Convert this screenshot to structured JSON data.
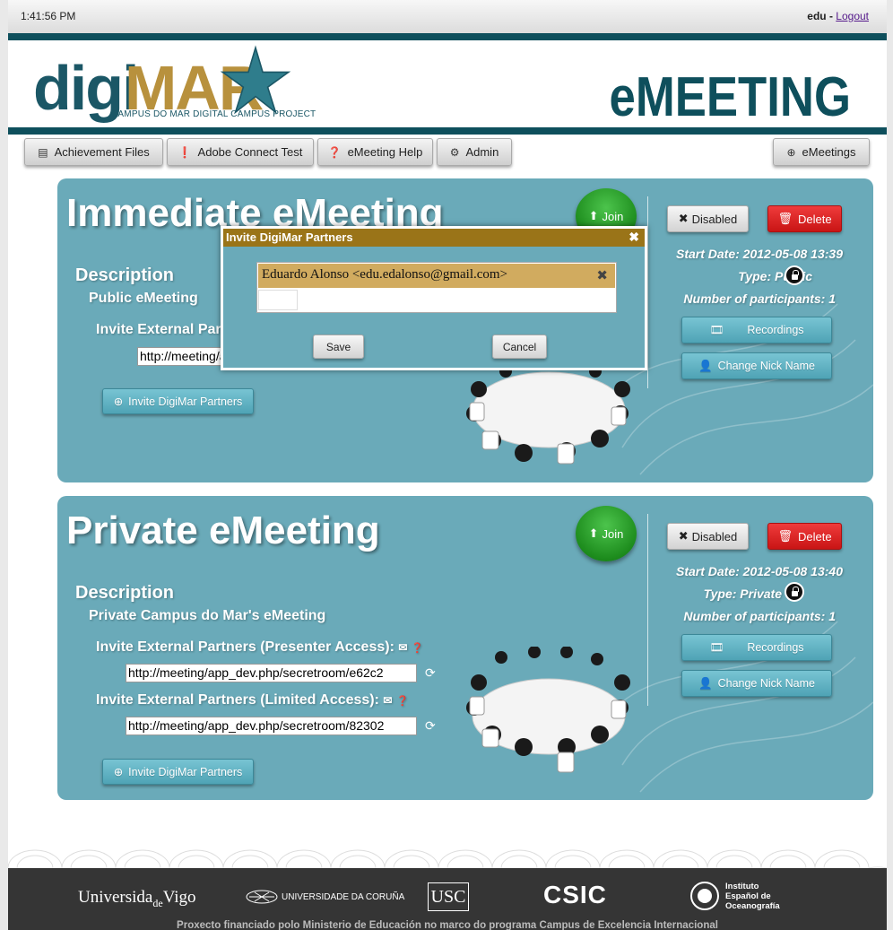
{
  "topbar": {
    "time": "1:41:56 PM",
    "username": "edu",
    "separator": " - ",
    "logout": "Logout"
  },
  "header": {
    "logo_digi": "digi",
    "logo_mar": "MAR",
    "logo_sub": "CAMPUS DO MAR DIGITAL CAMPUS PROJECT",
    "title": "eMEETING"
  },
  "nav": {
    "achievement": "Achievement Files",
    "adobe": "Adobe Connect Test",
    "help": "eMeeting Help",
    "admin": "Admin",
    "emeetings": "eMeetings"
  },
  "meetings": [
    {
      "title": "Immediate eMeeting",
      "join": "Join",
      "description_label": "Description",
      "description": "Public eMeeting",
      "invite_presenter_label": "Invite External Partners (Presenter Access):",
      "presenter_url": "http://meeting/app_dev.php/secretroom/e62c2",
      "invite_digimar": "Invite DigiMar Partners",
      "disabled": "Disabled",
      "delete": "Delete",
      "start_date": "Start Date: 2012-05-08 13:39",
      "type": "Type: Public",
      "participants": "Number of participants: 1",
      "recordings": "Recordings",
      "change_nick": "Change Nick Name"
    },
    {
      "title": "Private eMeeting",
      "join": "Join",
      "description_label": "Description",
      "description": "Private Campus do Mar's eMeeting",
      "invite_presenter_label": "Invite External Partners (Presenter Access):",
      "presenter_url": "http://meeting/app_dev.php/secretroom/e62c2",
      "invite_limited_label": "Invite External Partners (Limited Access):",
      "limited_url": "http://meeting/app_dev.php/secretroom/82302",
      "invite_digimar": "Invite DigiMar Partners",
      "disabled": "Disabled",
      "delete": "Delete",
      "start_date": "Start Date: 2012-05-08 13:40",
      "type": "Type: Private",
      "participants": "Number of participants: 1",
      "recordings": "Recordings",
      "change_nick": "Change Nick Name"
    }
  ],
  "dialog": {
    "title": "Invite DigiMar Partners",
    "selected": "Eduardo Alonso <edu.edalonso@gmail.com>",
    "save": "Save",
    "cancel": "Cancel"
  },
  "footer": {
    "vigo": "Universida de Vigo",
    "vigo_a": "Universida",
    "vigo_b": "de",
    "vigo_c": "Vigo",
    "coruna": "UNIVERSIDADE DA CORUÑA",
    "usc": "USC",
    "csic": "CSIC",
    "ieo": "Instituto Español de Oceanografía",
    "ieo_1": "Instituto",
    "ieo_2": "Español de",
    "ieo_3": "Oceanografía",
    "credit": "Proxecto financiado polo Ministerio de Educación no marco do programa Campus de Excelencia Internacional"
  },
  "colors": {
    "teal_dark": "#0e4f5c",
    "panel": "#6aaab9",
    "gold": "#b8913d",
    "dialog_title": "#9a7418",
    "join_green": "#1d8c1d",
    "delete_red": "#c91515"
  },
  "icons": [
    "list-icon",
    "alert-circle-icon",
    "help-circle-icon",
    "gear-icon",
    "plus-circle-icon",
    "x-icon",
    "trash-icon",
    "film-icon",
    "user-icon",
    "mail-icon",
    "help-icon",
    "refresh-icon",
    "lock-icon",
    "unlock-icon",
    "close-icon",
    "arrow-up-icon"
  ]
}
